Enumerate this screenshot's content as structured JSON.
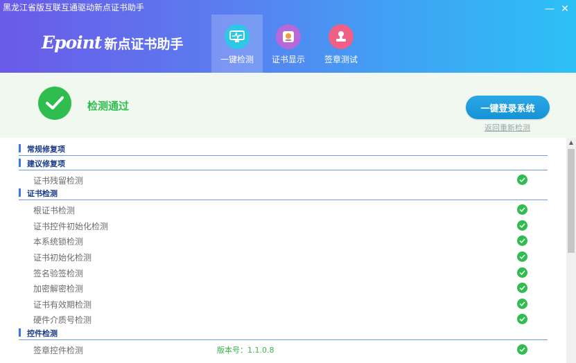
{
  "window": {
    "title": "黑龙江省版互联互通驱动新点证书助手",
    "minimize_glyph": "—",
    "close_glyph": "✕"
  },
  "logo": {
    "brand": "Epoint",
    "name": "新点证书助手"
  },
  "nav": {
    "tabs": [
      {
        "label": "一键检测",
        "icon": "monitor-icon",
        "color": "#2cc9e6",
        "active": true
      },
      {
        "label": "证书显示",
        "icon": "certificate-icon",
        "color": "#b56ad8",
        "active": false
      },
      {
        "label": "签章测试",
        "icon": "stamp-icon",
        "color": "#ef5f86",
        "active": false
      }
    ]
  },
  "status": {
    "text": "检测通过",
    "icon": "check-circle-icon",
    "color": "#2ebd4e",
    "login_button": "一键登录系统",
    "recheck_link": "返回重新检测"
  },
  "sections": [
    {
      "title": "常规修复项",
      "items": []
    },
    {
      "title": "建议修复项",
      "items": [
        {
          "label": "证书残留检测",
          "ok": true
        }
      ]
    },
    {
      "title": "证书检测",
      "items": [
        {
          "label": "根证书检测",
          "ok": true
        },
        {
          "label": "证书控件初始化检测",
          "ok": true
        },
        {
          "label": "本系统锁检测",
          "ok": true
        },
        {
          "label": "证书初始化检测",
          "ok": true
        },
        {
          "label": "签名验签检测",
          "ok": true
        },
        {
          "label": "加密解密检测",
          "ok": true
        },
        {
          "label": "证书有效期检测",
          "ok": true
        },
        {
          "label": "硬件介质号检测",
          "ok": true
        }
      ]
    },
    {
      "title": "控件检测",
      "items": [
        {
          "label": "签章控件检测",
          "version": "版本号：1.1.0.8",
          "ok": true
        }
      ]
    }
  ]
}
